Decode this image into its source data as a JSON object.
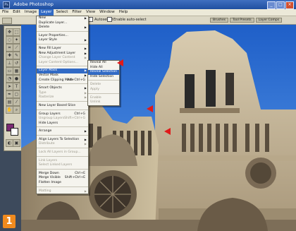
{
  "window": {
    "title": "Adobe Photoshop",
    "buttons": [
      "_",
      "□",
      "×"
    ]
  },
  "menubar": {
    "items": [
      "File",
      "Edit",
      "Image",
      "Layer",
      "Select",
      "Filter",
      "View",
      "Window",
      "Help"
    ],
    "active_index": 3
  },
  "options_bar": {
    "label1": "Autoselect",
    "label2": "Enable auto-select",
    "palette_tabs": [
      "Brushes",
      "Tool Presets",
      "Layer Comps"
    ]
  },
  "layer_menu": {
    "items": [
      {
        "label": "New",
        "arrow": true
      },
      {
        "label": "Duplicate Layer...",
        "arrow": false
      },
      {
        "label": "Delete",
        "arrow": true
      },
      {
        "sep": true
      },
      {
        "label": "Layer Properties...",
        "arrow": false
      },
      {
        "label": "Layer Style",
        "arrow": true
      },
      {
        "sep": true
      },
      {
        "label": "New Fill Layer",
        "arrow": true
      },
      {
        "label": "New Adjustment Layer",
        "arrow": true
      },
      {
        "label": "Change Layer Content",
        "arrow": true,
        "disabled": true
      },
      {
        "label": "Layer Content Options...",
        "arrow": false,
        "disabled": true
      },
      {
        "sep": true
      },
      {
        "label": "Layer Mask",
        "arrow": true,
        "highlight": true
      },
      {
        "label": "Vector Mask",
        "arrow": true
      },
      {
        "label": "Create Clipping Mask",
        "shortcut": "Alt+Ctrl+G"
      },
      {
        "sep": true
      },
      {
        "label": "Smart Objects",
        "arrow": true
      },
      {
        "label": "Type",
        "arrow": true,
        "disabled": true
      },
      {
        "label": "Rasterize",
        "arrow": true,
        "disabled": true
      },
      {
        "sep": true
      },
      {
        "label": "New Layer Based Slice",
        "arrow": false
      },
      {
        "sep": true
      },
      {
        "label": "Group Layers",
        "shortcut": "Ctrl+G"
      },
      {
        "label": "Ungroup Layers",
        "shortcut": "Shift+Ctrl+G",
        "disabled": true
      },
      {
        "label": "Hide Layers",
        "arrow": false
      },
      {
        "sep": true
      },
      {
        "label": "Arrange",
        "arrow": true
      },
      {
        "sep": true
      },
      {
        "label": "Align Layers To Selection",
        "arrow": true
      },
      {
        "label": "Distribute",
        "arrow": true,
        "disabled": true
      },
      {
        "sep": true
      },
      {
        "label": "Lock All Layers in Group...",
        "disabled": true
      },
      {
        "sep": true
      },
      {
        "label": "Link Layers",
        "disabled": true
      },
      {
        "label": "Select Linked Layers",
        "disabled": true
      },
      {
        "sep": true
      },
      {
        "label": "Merge Down",
        "shortcut": "Ctrl+E"
      },
      {
        "label": "Merge Visible",
        "shortcut": "Shift+Ctrl+E"
      },
      {
        "label": "Flatten Image",
        "arrow": false
      },
      {
        "sep": true
      },
      {
        "label": "Matting",
        "arrow": true,
        "disabled": true
      }
    ]
  },
  "layer_mask_submenu": {
    "items": [
      {
        "label": "Reveal All"
      },
      {
        "label": "Hide All"
      },
      {
        "label": "Reveal Selection",
        "highlight": true
      },
      {
        "label": "Hide Selection"
      },
      {
        "sep": true
      },
      {
        "label": "Delete",
        "disabled": true
      },
      {
        "label": "Apply",
        "disabled": true
      },
      {
        "sep": true
      },
      {
        "label": "Enable",
        "disabled": true
      },
      {
        "label": "Unlink",
        "disabled": true
      }
    ]
  },
  "badge": {
    "step": "1"
  },
  "colors": {
    "accent": "#316ac5",
    "arrow": "#e01a1a",
    "badge": "#f08a1e",
    "sky": "#2f6fd0",
    "stone": "#c9b99a"
  }
}
